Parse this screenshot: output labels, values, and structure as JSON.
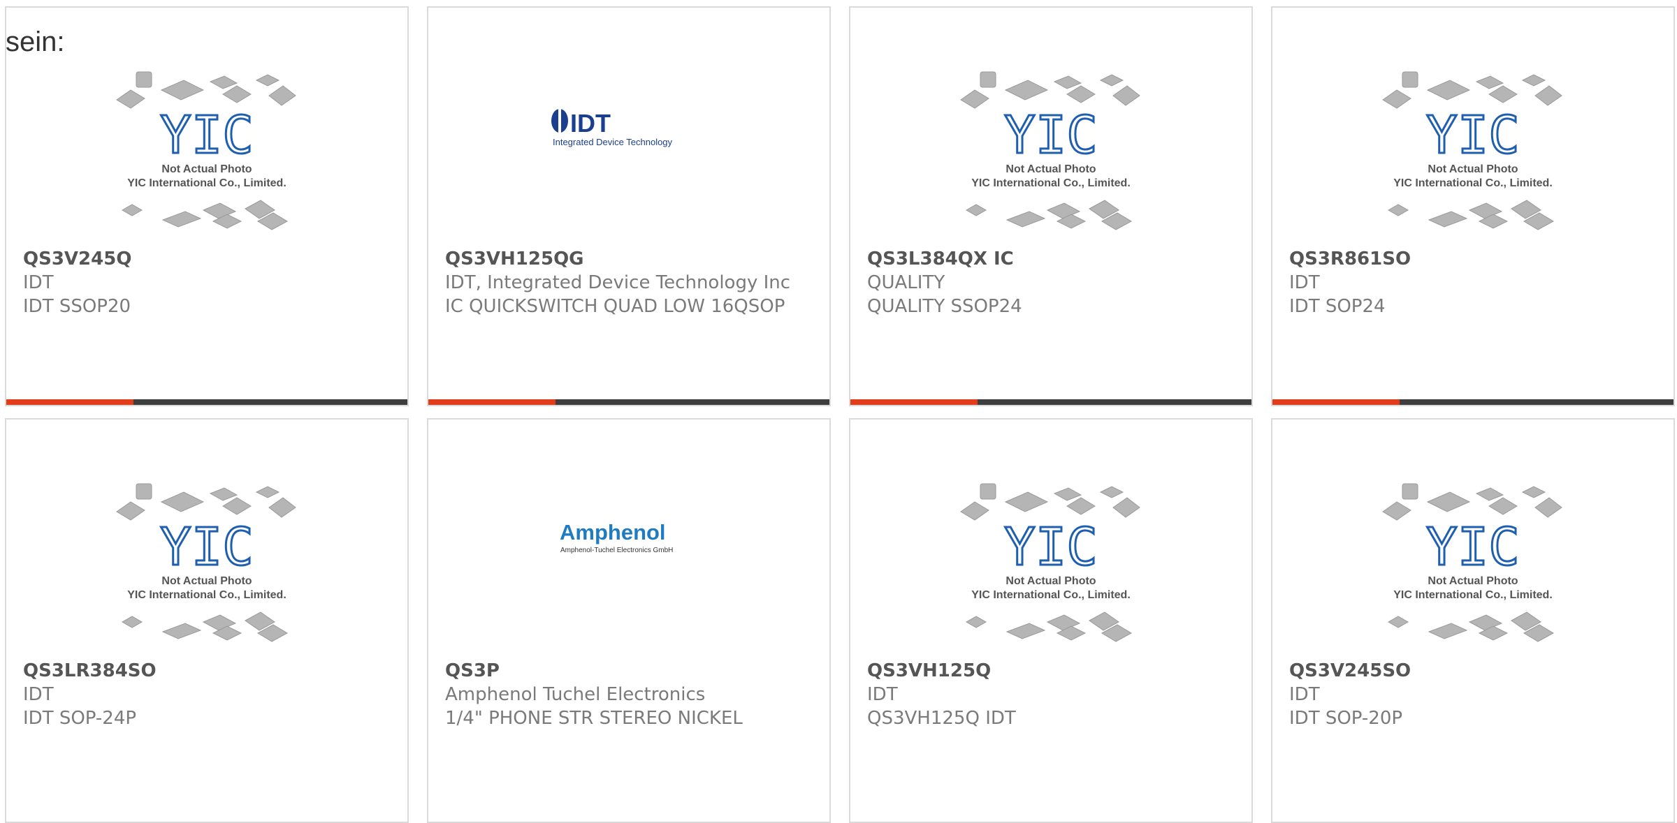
{
  "lead_text": "sein:",
  "placeholder": {
    "line1": "Not Actual Photo",
    "line2": "YIC International Co., Limited.",
    "mark": "YIC"
  },
  "logos": {
    "idt": {
      "mark": "IDT",
      "tagline": "Integrated Device Technology"
    },
    "amphenol": {
      "mark": "Amphenol",
      "tagline": "Amphenol-Tuchel Electronics GmbH"
    }
  },
  "products": [
    {
      "part": "QS3V245Q",
      "manufacturer": "IDT",
      "desc": "IDT SSOP20",
      "image": "placeholder"
    },
    {
      "part": "QS3VH125QG",
      "manufacturer": "IDT, Integrated Device Technology Inc",
      "desc": "IC QUICKSWITCH QUAD LOW 16QSOP",
      "image": "idt"
    },
    {
      "part": "QS3L384QX IC",
      "manufacturer": "QUALITY",
      "desc": "QUALITY SSOP24",
      "image": "placeholder"
    },
    {
      "part": "QS3R861SO",
      "manufacturer": "IDT",
      "desc": "IDT SOP24",
      "image": "placeholder"
    },
    {
      "part": "QS3LR384SO",
      "manufacturer": "IDT",
      "desc": "IDT SOP-24P",
      "image": "placeholder"
    },
    {
      "part": "QS3P",
      "manufacturer": "Amphenol Tuchel Electronics",
      "desc": "1/4\" PHONE STR STEREO NICKEL",
      "image": "amphenol"
    },
    {
      "part": "QS3VH125Q",
      "manufacturer": "IDT",
      "desc": "QS3VH125Q IDT",
      "image": "placeholder"
    },
    {
      "part": "QS3V245SO",
      "manufacturer": "IDT",
      "desc": "IDT SOP-20P",
      "image": "placeholder"
    }
  ],
  "colors": {
    "accent_bar": "#e23d1b",
    "dark_bar": "#3e3e3e",
    "yic_blue": "#1f5fb0",
    "idt_blue": "#1a3f8f",
    "amphenol_blue": "#1f7cc0"
  }
}
